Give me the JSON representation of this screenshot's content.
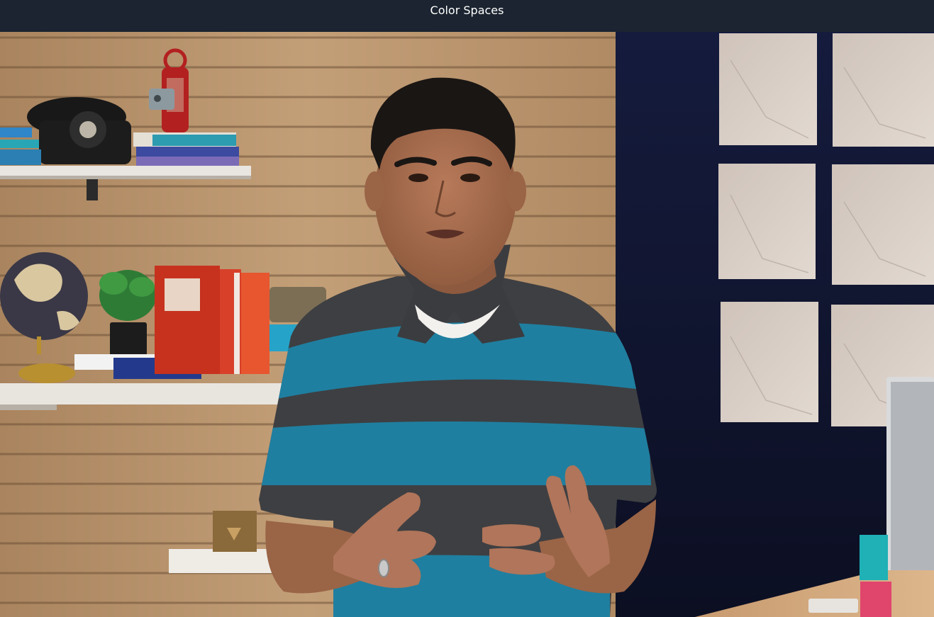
{
  "window": {
    "title": "Color Spaces"
  },
  "video": {
    "scene": "presenter-in-studio",
    "colors": {
      "title_bar": "#1b2430",
      "wood_wall": "#b89570",
      "navy_wall": "#141a3a",
      "panel": "#d6ccc4",
      "shirt_teal": "#1f7fa0",
      "shirt_gray": "#3e3f42"
    }
  }
}
